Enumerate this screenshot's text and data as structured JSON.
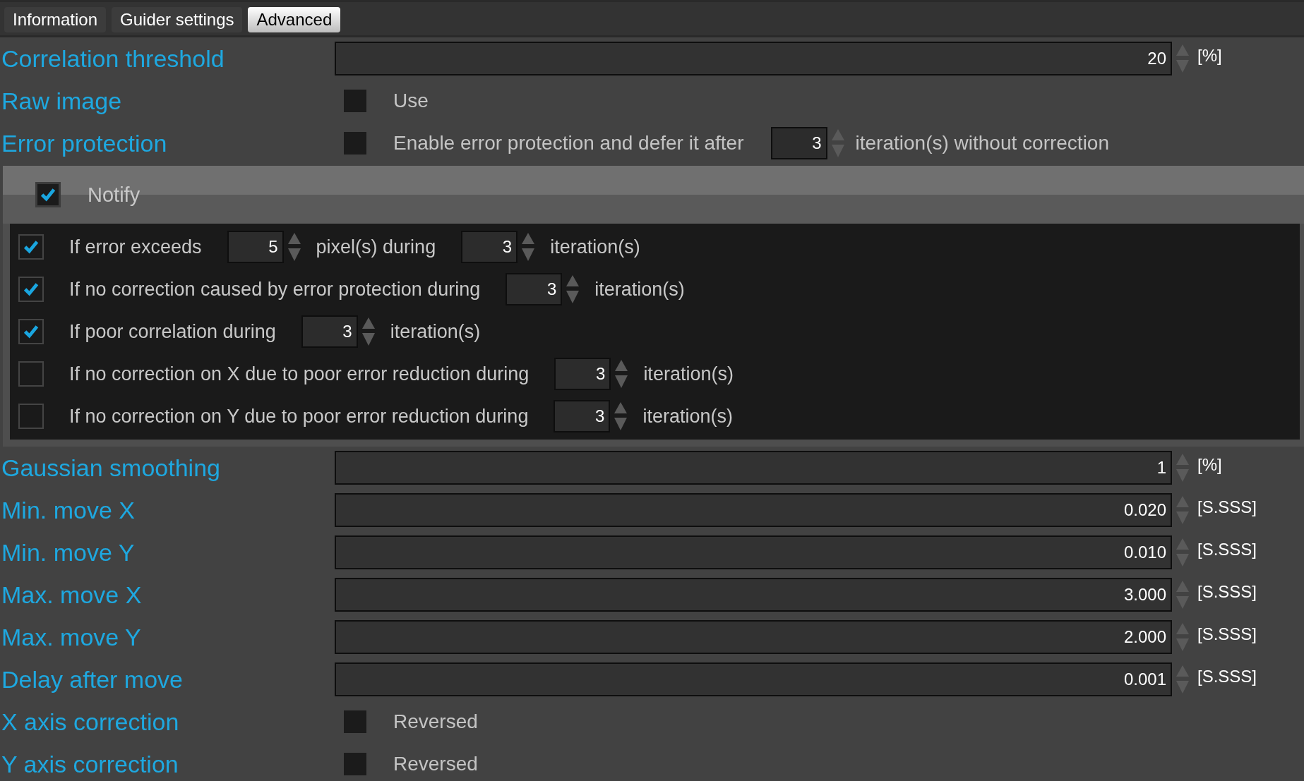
{
  "tabs": [
    {
      "label": "Information",
      "selected": false
    },
    {
      "label": "Guider settings",
      "selected": false
    },
    {
      "label": "Advanced",
      "selected": true
    }
  ],
  "top_rows": [
    {
      "kind": "number",
      "label": "Correlation threshold",
      "value": "20",
      "unit": "[%]"
    },
    {
      "kind": "checkbox",
      "label": "Raw image",
      "checked": false,
      "text": "Use"
    },
    {
      "kind": "checkbox_spin",
      "label": "Error protection",
      "checked": false,
      "text": "Enable error protection and defer it after",
      "value": "3",
      "suffix": "iteration(s) without correction"
    }
  ],
  "notify": {
    "label": "Notify",
    "checked": true,
    "conditions": [
      {
        "checked": true,
        "segments": [
          {
            "kind": "text",
            "text": "If error exceeds"
          },
          {
            "kind": "spin",
            "value": "5"
          },
          {
            "kind": "text",
            "text": "pixel(s) during"
          },
          {
            "kind": "spin",
            "value": "3"
          },
          {
            "kind": "text",
            "text": "iteration(s)"
          }
        ]
      },
      {
        "checked": true,
        "segments": [
          {
            "kind": "text",
            "text": "If no correction caused by error protection during"
          },
          {
            "kind": "spin",
            "value": "3"
          },
          {
            "kind": "text",
            "text": "iteration(s)"
          }
        ]
      },
      {
        "checked": true,
        "segments": [
          {
            "kind": "text",
            "text": "If poor correlation during"
          },
          {
            "kind": "spin",
            "value": "3"
          },
          {
            "kind": "text",
            "text": "iteration(s)"
          }
        ]
      },
      {
        "checked": false,
        "segments": [
          {
            "kind": "text",
            "text": "If no correction on X due to poor error reduction during"
          },
          {
            "kind": "spin",
            "value": "3"
          },
          {
            "kind": "text",
            "text": "iteration(s)"
          }
        ]
      },
      {
        "checked": false,
        "segments": [
          {
            "kind": "text",
            "text": "If no correction on Y due to poor error reduction during"
          },
          {
            "kind": "spin",
            "value": "3"
          },
          {
            "kind": "text",
            "text": "iteration(s)"
          }
        ]
      }
    ]
  },
  "bottom_rows": [
    {
      "kind": "number",
      "label": "Gaussian smoothing",
      "value": "1",
      "unit": "[%]"
    },
    {
      "kind": "number",
      "label": "Min. move X",
      "value": "0.020",
      "unit": "[S.SSS]"
    },
    {
      "kind": "number",
      "label": "Min. move Y",
      "value": "0.010",
      "unit": "[S.SSS]"
    },
    {
      "kind": "number",
      "label": "Max. move X",
      "value": "3.000",
      "unit": "[S.SSS]"
    },
    {
      "kind": "number",
      "label": "Max. move Y",
      "value": "2.000",
      "unit": "[S.SSS]"
    },
    {
      "kind": "number",
      "label": "Delay after move",
      "value": "0.001",
      "unit": "[S.SSS]"
    },
    {
      "kind": "checkbox",
      "label": "X axis correction",
      "checked": false,
      "text": "Reversed"
    },
    {
      "kind": "checkbox",
      "label": "Y axis correction",
      "checked": false,
      "text": "Reversed"
    }
  ]
}
